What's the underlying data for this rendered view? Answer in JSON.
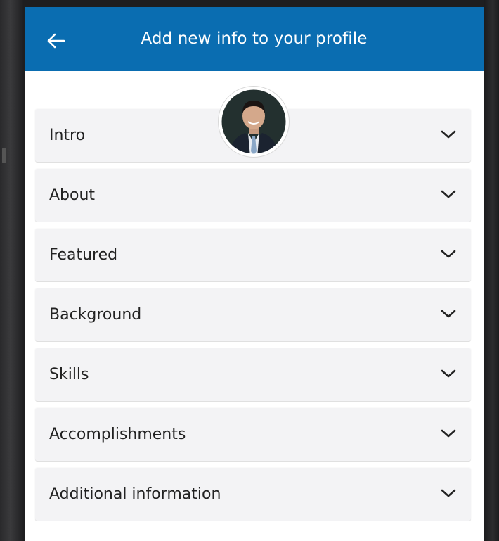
{
  "header": {
    "title": "Add new info to your profile",
    "back_icon": "arrow-left-icon"
  },
  "colors": {
    "app_bar": "#0a6db1",
    "section_bg": "#f3f3f5",
    "text": "#222222"
  },
  "sections": [
    {
      "label": "Intro"
    },
    {
      "label": "About"
    },
    {
      "label": "Featured"
    },
    {
      "label": "Background"
    },
    {
      "label": "Skills"
    },
    {
      "label": "Accomplishments"
    },
    {
      "label": "Additional information"
    }
  ],
  "section_icon": "chevron-down-icon",
  "avatar": {
    "icon": "profile-photo"
  }
}
